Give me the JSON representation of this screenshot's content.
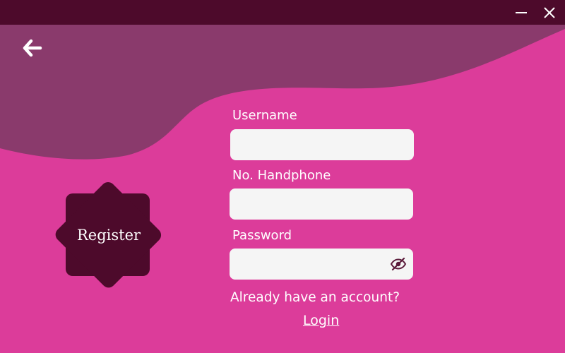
{
  "window": {
    "minimize_icon": "minimize-icon",
    "close_icon": "close-icon",
    "titlebar_color": "#4d0a2b"
  },
  "theme": {
    "background": "#dc3c9a",
    "wave": "#8a3a6c",
    "badge": "#4d0a2b",
    "field_bg": "#f5f5f5"
  },
  "nav": {
    "back_icon": "arrow-left-icon"
  },
  "badge": {
    "label": "Register"
  },
  "form": {
    "username": {
      "label": "Username",
      "value": "",
      "placeholder": ""
    },
    "phone": {
      "label": "No. Handphone",
      "value": "",
      "placeholder": ""
    },
    "password": {
      "label": "Password",
      "value": "",
      "placeholder": "",
      "toggle_icon": "eye-slash-icon"
    }
  },
  "footer": {
    "prompt": "Already have an account?",
    "login_link": "Login"
  }
}
